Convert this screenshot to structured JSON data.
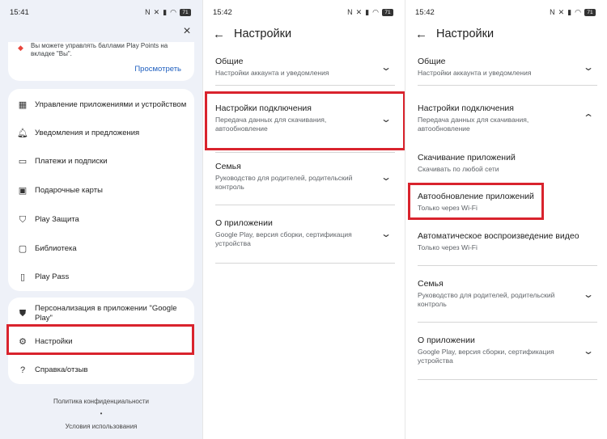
{
  "colors": {
    "highlight": "#d9232d",
    "link": "#1f5fbf",
    "panel_bg": "#eef1f8"
  },
  "status": {
    "time1": "15:41",
    "time2": "15:42",
    "time3": "15:42",
    "battery": "71"
  },
  "p1": {
    "close_icon": "×",
    "points_text": "Вы можете управлять баллами Play Points на вкладке \"Вы\".",
    "view_link": "Просмотреть",
    "menu": [
      {
        "icon": "grid-icon",
        "label": "Управление приложениями и устройством"
      },
      {
        "icon": "bell-icon",
        "label": "Уведомления и предложения"
      },
      {
        "icon": "card-icon",
        "label": "Платежи и подписки"
      },
      {
        "icon": "gift-icon",
        "label": "Подарочные карты"
      },
      {
        "icon": "shield-icon",
        "label": "Play Защита"
      },
      {
        "icon": "folder-icon",
        "label": "Библиотека"
      },
      {
        "icon": "bookmark-icon",
        "label": "Play Pass"
      }
    ],
    "bottom": [
      {
        "icon": "personalize-icon",
        "label": "Персонализация в приложении \"Google Play\""
      },
      {
        "icon": "gear-icon",
        "label": "Настройки"
      },
      {
        "icon": "help-icon",
        "label": "Справка/отзыв"
      }
    ],
    "privacy": "Политика конфиденциальности",
    "dot": "•",
    "terms": "Условия использования"
  },
  "p2": {
    "title": "Настройки",
    "rows": [
      {
        "title": "Общие",
        "sub": "Настройки аккаунта и уведомления"
      },
      {
        "title": "Настройки подключения",
        "sub": "Передача данных для скачивания, автообновление"
      },
      {
        "title": "Семья",
        "sub": "Руководство для родителей, родительский контроль"
      },
      {
        "title": "О приложении",
        "sub": "Google Play, версия сборки, сертификация устройства"
      }
    ]
  },
  "p3": {
    "title": "Настройки",
    "rows": [
      {
        "title": "Общие",
        "sub": "Настройки аккаунта и уведомления"
      },
      {
        "title": "Настройки подключения",
        "sub": "Передача данных для скачивания, автообновление"
      },
      {
        "title": "Скачивание приложений",
        "sub": "Скачивать по любой сети"
      },
      {
        "title": "Автообновление приложений",
        "sub": "Только через Wi-Fi"
      },
      {
        "title": "Автоматическое воспроизведение видео",
        "sub": "Только через Wi-Fi"
      },
      {
        "title": "Семья",
        "sub": "Руководство для родителей, родительский контроль"
      },
      {
        "title": "О приложении",
        "sub": "Google Play, версия сборки, сертификация устройства"
      }
    ]
  }
}
